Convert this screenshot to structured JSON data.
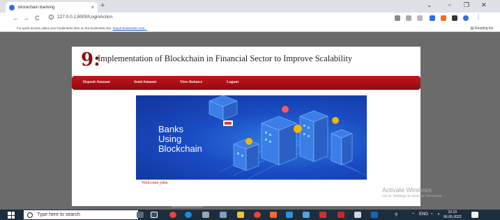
{
  "browser": {
    "tab_title": "Blockchain Banking",
    "tab_close": "×",
    "new_tab": "+",
    "window_controls": {
      "collapse": "⌄",
      "minimize": "−",
      "maximize": "❐",
      "close": "✕"
    },
    "nav": {
      "back": "←",
      "forward": "→",
      "reload": "C"
    },
    "url": "127.0.0.1:8000/LoginAction",
    "bookmarks_message": "For quick access, place your bookmarks here on the bookmarks bar.",
    "bookmarks_link": "Import bookmarks now...",
    "reading_list": "Reading list"
  },
  "page": {
    "logo": "9:",
    "title": "Implementation of Blockchain in Financial Sector to Improve Scalability",
    "menu": [
      "Deposit Amount",
      "Send Amount",
      "View Balance",
      "Logout"
    ],
    "banner_text": [
      "Banks",
      "Using",
      "Blockchain"
    ],
    "welcome": "Welcome john"
  },
  "overlay": {
    "activate_title": "Activate Windows",
    "activate_sub": "Go to Settings to activate Windows."
  },
  "taskbar": {
    "search_placeholder": "Type here to search",
    "time": "22:10",
    "date": "06-05-2022",
    "language": "ENG"
  },
  "colors": {
    "accent": "#c4151c",
    "banner": "#1a4cc4",
    "taskbar": "#1c2d3e"
  }
}
